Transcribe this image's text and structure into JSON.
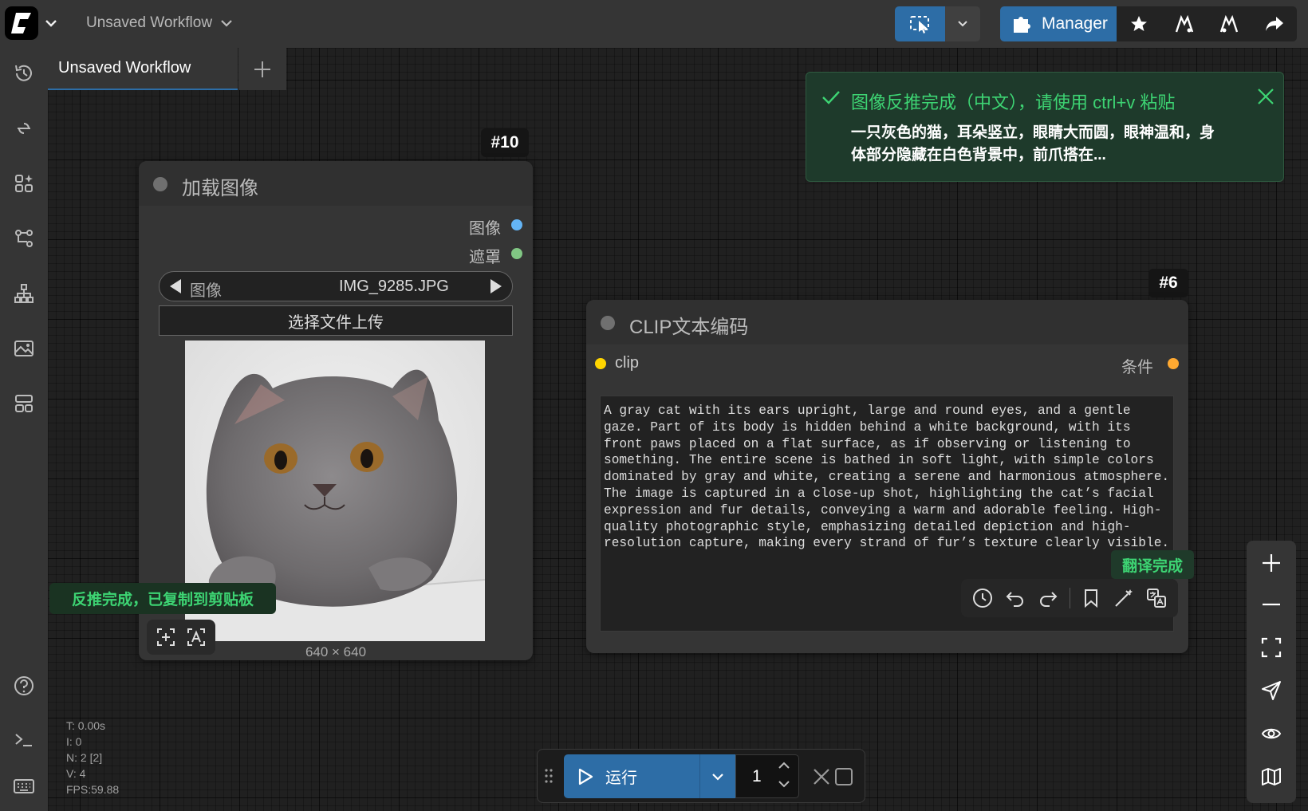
{
  "topbar": {
    "workflow_title": "Unsaved Workflow",
    "manager_label": "Manager"
  },
  "tabs": [
    {
      "label": "Unsaved Workflow",
      "modified": true
    }
  ],
  "toast": {
    "title": "图像反推完成（中文），请使用 ctrl+v 粘贴",
    "body": "一只灰色的猫，耳朵竖立，眼睛大而圆，眼神温和，身体部分隐藏在白色背景中，前爪搭在..."
  },
  "load_image_node": {
    "id": "#10",
    "title": "加载图像",
    "outputs": [
      {
        "label": "图像",
        "color": "#64b5f6"
      },
      {
        "label": "遮罩",
        "color": "#81c784"
      }
    ],
    "combo_label": "图像",
    "combo_value": "IMG_9285.JPG",
    "upload_label": "选择文件上传",
    "dimensions": "640 × 640"
  },
  "clip_node": {
    "id": "#6",
    "title": "CLIP文本编码",
    "input_label": "clip",
    "input_color": "#ffd500",
    "output_label": "条件",
    "output_color": "#ffa931",
    "text": "A gray cat with its ears upright, large and round eyes, and a gentle\ngaze. Part of its body is hidden behind a white background, with its\nfront paws placed on a flat surface, as if observing or listening to\nsomething. The entire scene is bathed in soft light, with simple colors\ndominated by gray and white, creating a serene and harmonious atmosphere.\nThe image is captured in a close-up shot, highlighting the cat’s facial\nexpression and fur details, conveying a warm and adorable feeling. High-\nquality photographic style, emphasizing detailed depiction and high-\nresolution capture, making every strand of fur’s texture clearly visible.",
    "translate_badge": "翻译完成"
  },
  "copied_toast": "反推完成，已复制到剪贴板",
  "stats": {
    "t": "T: 0.00s",
    "i": "I: 0",
    "n": "N: 2 [2]",
    "v": "V: 4",
    "fps": "FPS:59.88"
  },
  "runbar": {
    "run_label": "运行",
    "batch_count": "1"
  },
  "colors": {
    "accent": "#2d6da6",
    "success": "#3dd473",
    "toast_bg": "#1e3a2b"
  }
}
